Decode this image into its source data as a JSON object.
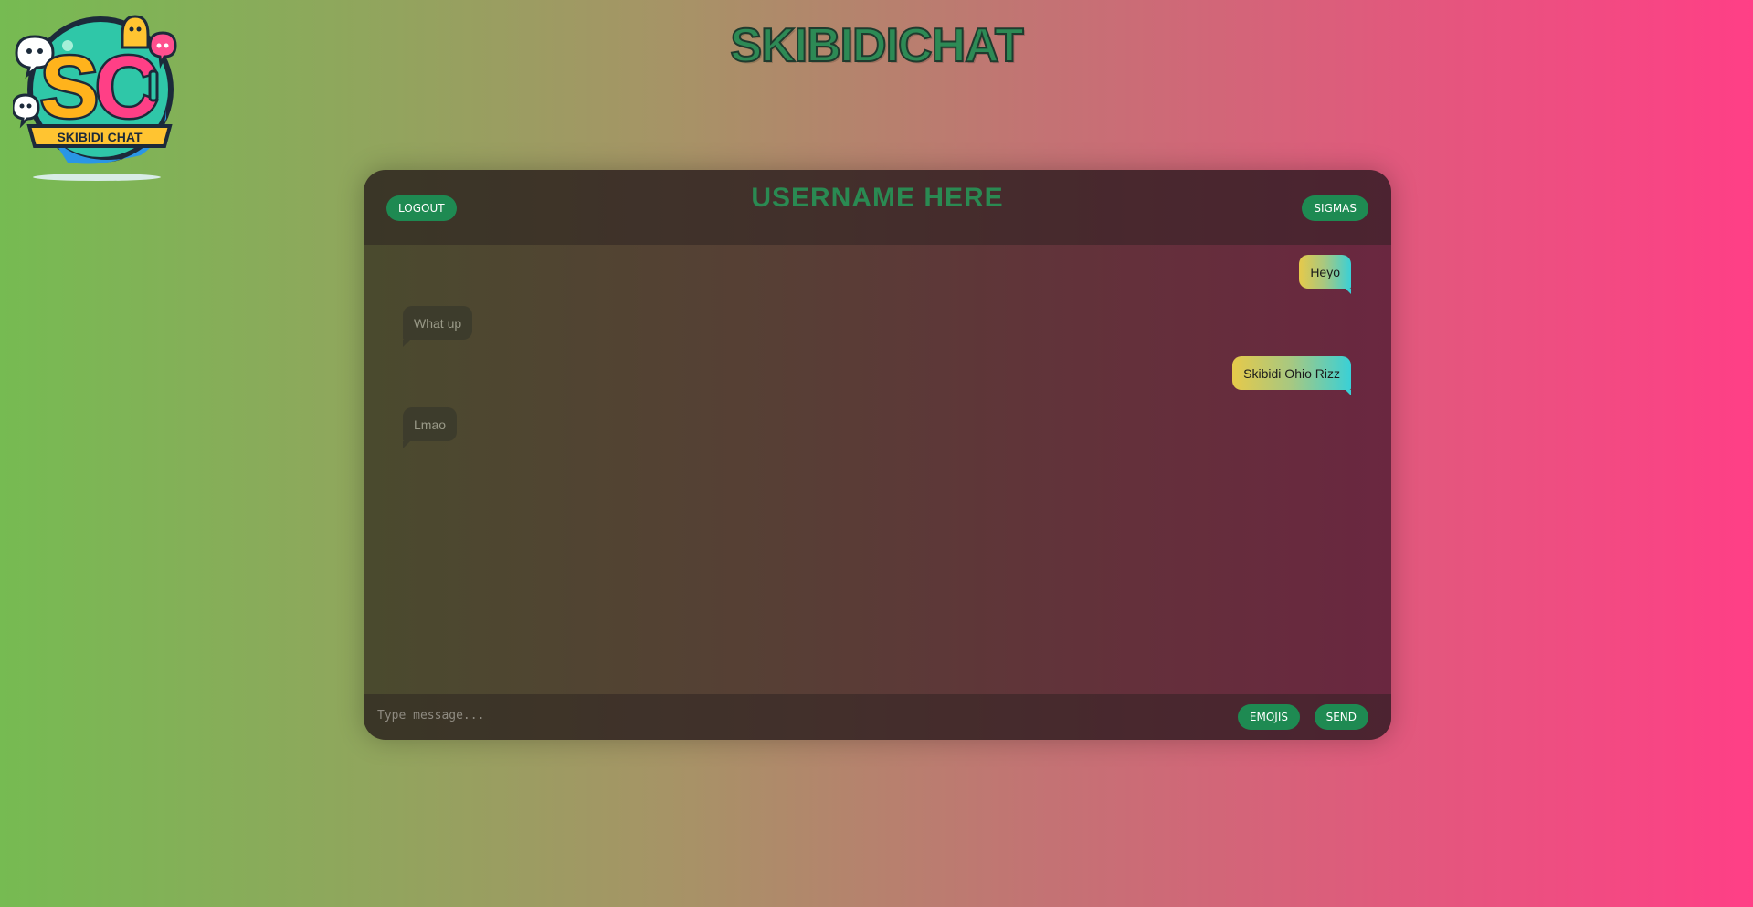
{
  "app": {
    "title": "SKIBIDICHAT",
    "logo_text": "SKIBIDI CHAT",
    "logo_letters": "SC"
  },
  "header": {
    "username": "USERNAME HERE",
    "logout_label": "LOGOUT",
    "sigmas_label": "SIGMAS"
  },
  "messages": [
    {
      "text": "Heyo",
      "direction": "outgoing"
    },
    {
      "text": "What up",
      "direction": "incoming"
    },
    {
      "text": "Skibidi Ohio Rizz",
      "direction": "outgoing"
    },
    {
      "text": "Lmao",
      "direction": "incoming"
    }
  ],
  "composer": {
    "placeholder": "Type message...",
    "value": "",
    "emojis_label": "EMOJIS",
    "send_label": "SEND"
  },
  "colors": {
    "accent": "#1e8a52",
    "outgoing_bubble_start": "#e6c94a",
    "outgoing_bubble_end": "#3ad0d6",
    "incoming_bubble": "#3d3c2c"
  }
}
